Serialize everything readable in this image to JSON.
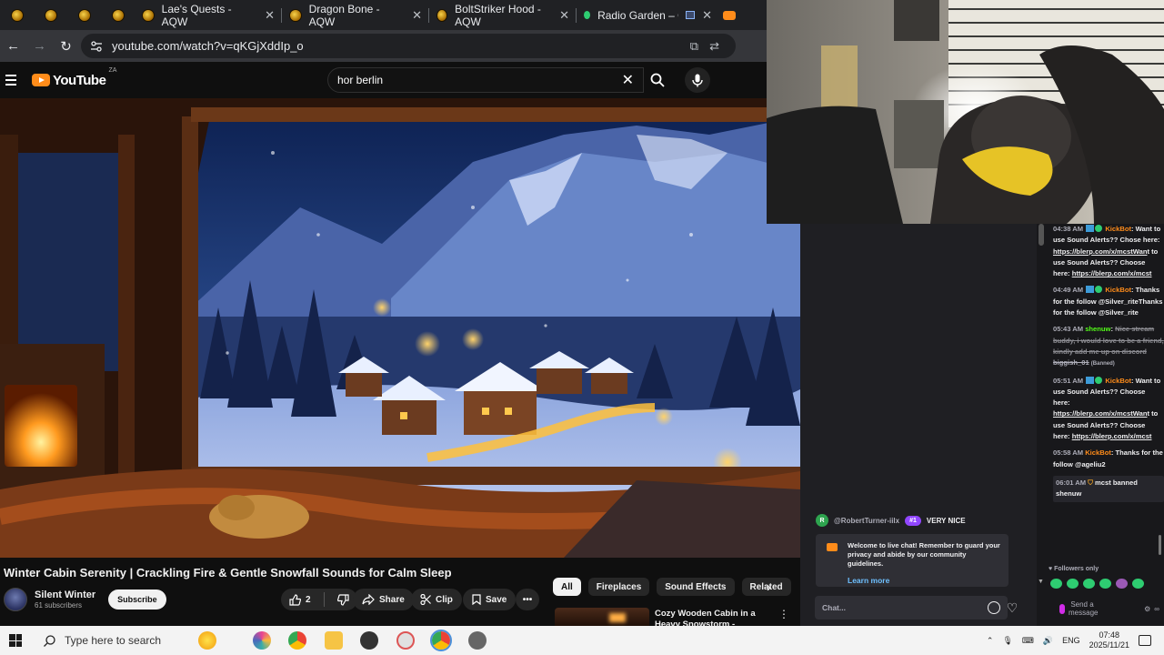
{
  "browser": {
    "tabs": [
      {
        "title": ""
      },
      {
        "title": ""
      },
      {
        "title": ""
      },
      {
        "title": ""
      },
      {
        "title": "Lae's Quests - AQW"
      },
      {
        "title": "Dragon Bone - AQW"
      },
      {
        "title": "BoltStriker Hood - AQW"
      },
      {
        "title": "Radio Garden – Glob"
      }
    ],
    "close_glyph": "✕",
    "url": "youtube.com/watch?v=qKGjXddIp_o"
  },
  "youtube": {
    "logo_text": "YouTube",
    "country_code": "ZA",
    "search_query": "hor berlin",
    "video_title": "Winter Cabin Serenity | Crackling Fire & Gentle Snowfall Sounds for Calm Sleep",
    "channel_name": "Silent Winter",
    "subscriber_count": "61 subscribers",
    "subscribe_label": "Subscribe",
    "like_count": "2",
    "share_label": "Share",
    "clip_label": "Clip",
    "save_label": "Save",
    "chips": [
      "All",
      "Fireplaces",
      "Sound Effects",
      "Related"
    ],
    "rec_title": "Cozy Wooden Cabin in a Heavy Snowstorm - Crackling"
  },
  "chat": {
    "messages": [
      {
        "time": "04:38 AM",
        "user": "KickBot",
        "text": "Want to use Sound Alerts?? Chose here: ",
        "link": "https://blerp.com/x/mcstWan",
        "after": "t to use Sound Alerts?? Choose here: ",
        "link2": "https://blerp.com/x/mcst"
      },
      {
        "time": "04:49 AM",
        "user": "KickBot",
        "text": "Thanks for the follow @Silver_riteThanks for the follow @Silver_rite"
      },
      {
        "time": "05:43 AM",
        "user": "shenuw",
        "text": "Nice stream buddy, i would love to be a friend, kindly add me up on discord",
        "tail": "biggish_01",
        "tail_note": "(Banned)"
      },
      {
        "time": "05:51 AM",
        "user": "KickBot",
        "text": "Want to use Sound Alerts?? Choose here: ",
        "link": "https://blerp.com/x/mcstWan",
        "after": "t to use Sound Alerts?? Choose here: ",
        "link2": "https://blerp.com/x/mcst"
      },
      {
        "time": "05:58 AM",
        "user": "KickBot",
        "text": "Thanks for the follow @ageliu2"
      },
      {
        "time": "06:01 AM",
        "text": "mcst banned shenuw"
      }
    ],
    "highlight": {
      "avatar_letter": "R",
      "user": "@RobertTurner-iilx",
      "badge": "#1",
      "text": "VERY NICE"
    },
    "welcome_text": "Welcome to live chat! Remember to guard your privacy and abide by our community guidelines.",
    "learn_more": "Learn more",
    "input_placeholder": "Chat...",
    "followers_only": "Followers only",
    "send_label": "Send a message"
  },
  "taskbar": {
    "search_placeholder": "Type here to search",
    "language": "ENG",
    "time": "07:48",
    "date": "2025/11/21"
  },
  "colors": {
    "youtube_accent": "#ff8c1a",
    "kick_green": "#53fc18",
    "kickbot_name": "#ff8c1a",
    "chat_bg": "#18181b"
  }
}
